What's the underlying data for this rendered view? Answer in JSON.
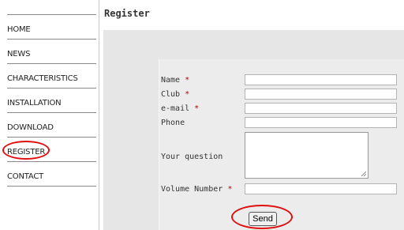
{
  "header": {
    "title": "Register"
  },
  "nav": {
    "items": [
      {
        "label": "HOME"
      },
      {
        "label": "NEWS"
      },
      {
        "label": "CHARACTERISTICS"
      },
      {
        "label": "INSTALLATION"
      },
      {
        "label": "DOWNLOAD"
      },
      {
        "label": "REGISTER"
      },
      {
        "label": "CONTACT"
      }
    ]
  },
  "form": {
    "required_marker": "*",
    "fields": [
      {
        "label": "Name",
        "value": ""
      },
      {
        "label": "Club",
        "value": ""
      },
      {
        "label": "e-mail",
        "value": ""
      },
      {
        "label": "Phone",
        "value": ""
      },
      {
        "label": "Your question",
        "value": ""
      },
      {
        "label": "Volume Number",
        "value": ""
      }
    ],
    "send_label": "Send"
  },
  "colors": {
    "highlight": "#e01010",
    "required": "#c00000",
    "panel": "#e6e6e6"
  }
}
